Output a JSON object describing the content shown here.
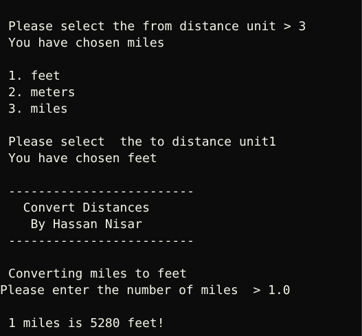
{
  "terminal": {
    "lines": [
      "Please select the from distance unit > 3",
      "You have chosen miles",
      "1. feet",
      "2. meters",
      "3. miles",
      "Please select  the to distance unit1",
      "You have chosen feet",
      "-------------------------",
      "  Convert Distances",
      "   By Hassan Nisar",
      "-------------------------",
      "Converting miles to feet",
      "Please enter the number of miles  > 1.0",
      "1 miles is 5280 feet!"
    ]
  },
  "colors": {
    "background": "#0c0c0c",
    "text": "#f2f2e6"
  }
}
